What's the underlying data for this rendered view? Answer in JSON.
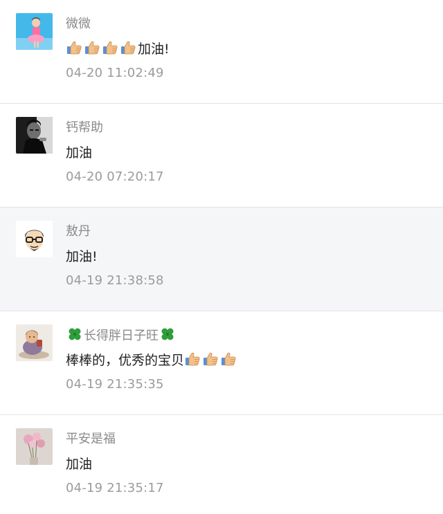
{
  "comments": [
    {
      "avatar_icon": "girl-photo-avatar",
      "name": "微微",
      "text_suffix": "加油!",
      "leading_emojis": [
        "thumbs-up-icon",
        "thumbs-up-icon",
        "thumbs-up-icon",
        "thumbs-up-icon"
      ],
      "time": "04-20 11:02:49"
    },
    {
      "avatar_icon": "man-photo-avatar",
      "name": "钙帮助",
      "text": "加油",
      "time": "04-20 07:20:17"
    },
    {
      "avatar_icon": "cartoon-face-avatar",
      "name": "敖丹",
      "text": "加油!",
      "time": "04-19 21:38:58"
    },
    {
      "avatar_icon": "figurine-photo-avatar",
      "name_decoration": "four-leaf-clover-icon",
      "name": "长得胖日子旺",
      "text": "棒棒的，优秀的宝贝",
      "trailing_emojis": [
        "thumbs-up-icon",
        "thumbs-up-icon",
        "thumbs-up-icon"
      ],
      "time": "04-19 21:35:35"
    },
    {
      "avatar_icon": "flower-photo-avatar",
      "name": "平安是福",
      "text": "加油",
      "time": "04-19 21:35:17"
    }
  ],
  "colors": {
    "highlight_row": "#f5f6f8",
    "name_text": "#8a8a8a",
    "time_text": "#9b9b9b",
    "divider": "#e3e3e3"
  }
}
